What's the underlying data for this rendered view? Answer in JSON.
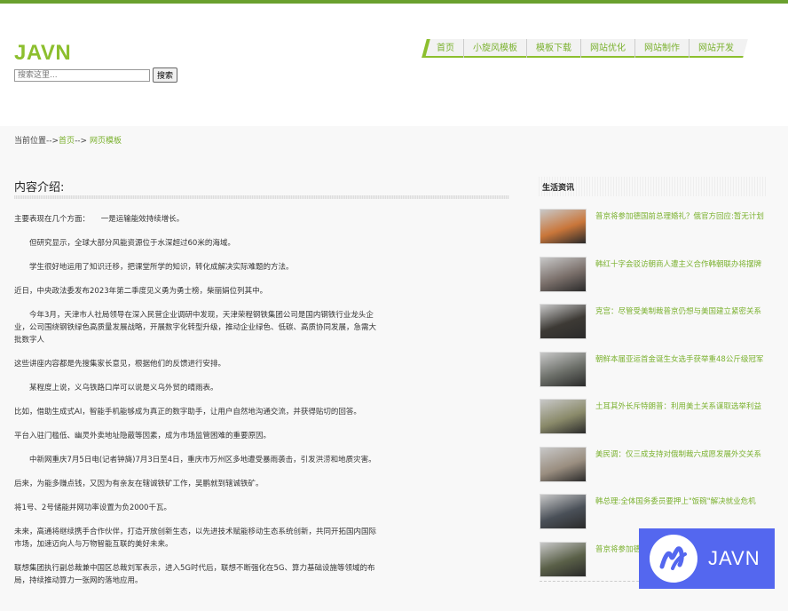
{
  "header": {
    "logo": "JAVN",
    "search_placeholder": "搜索这里...",
    "search_button": "搜索"
  },
  "nav": [
    {
      "label": "首页"
    },
    {
      "label": "小旋风模板"
    },
    {
      "label": "模板下载"
    },
    {
      "label": "网站优化"
    },
    {
      "label": "网站制作"
    },
    {
      "label": "网站开发"
    }
  ],
  "breadcrumb": {
    "prefix": "当前位置-->",
    "home": "首页",
    "sep": "--> ",
    "current": "网页模板"
  },
  "content": {
    "title": "内容介绍:",
    "paragraphs": [
      "主要表现在几个方面：　　一是运输能效持续增长。",
      "　　但研究显示，全球大部分风能资源位于水深超过60米的海域。",
      "　　学生很好地运用了知识迁移，把课堂所学的知识，转化成解决实际难题的方法。",
      "近日，中央政法委发布2023年第二季度见义勇为勇士榜，柴丽娟位列其中。",
      "　　今年3月，天津市人社局领导在深入民营企业调研中发现，天津荣程钢铁集团公司是国内钢铁行业龙头企业，公司围绕钢铁绿色高质量发展战略，开展数字化转型升级，推动企业绿色、低碳、高质协同发展，急需大批数字人",
      "这些讲座内容都是先搜集家长意见，根据他们的反馈进行安排。",
      "　　某程度上说，义乌铁路口岸可以说是义乌外贸的晴雨表。",
      "比如，借助生成式AI，智能手机能够成为真正的数字助手，让用户自然地沟通交流，并获得贴切的回答。",
      "平台入驻门槛低、幽灵外卖地址隐蔽等因素，成为市场监管困难的重要原因。",
      "　　中新网重庆7月5日电(记者钟旖)7月3日至4日，重庆市万州区多地遭受暴雨袭击，引发洪涝和地质灾害。",
      "后来，为能多赚点钱，又因为有亲友在辖诚铁矿工作，吴鹏就到辖诚铁矿。",
      "将1号、2号储能并网功率设置为负2000千瓦。",
      "未来，高通将继续携手合作伙伴，打造开放创新生态，以先进技术赋能移动生态系统创新，共同开拓国内国际市场，加速迈向人与万物智能互联的美好未来。",
      "联想集团执行副总裁兼中国区总裁刘军表示，进入5G时代后，联想不断强化在5G、算力基础设施等领域的布局，持续推动算力一张网的落地应用。"
    ]
  },
  "sidebar": {
    "title": "生活资讯",
    "items": [
      {
        "text": "普京将参加德国前总理婚礼？俄官方回应:暂无计划",
        "color": "#c9763a"
      },
      {
        "text": "韩红十字会驳访朝商人遭主义合作韩朝联办将摆牌",
        "color": "#7a6f6a"
      },
      {
        "text": "克宫：尽管受美制裁普京仍想与美国建立紧密关系",
        "color": "#3d3a35"
      },
      {
        "text": "朝鲜本届亚运首金诞生女选手获举重48公斤级冠军",
        "color": "#6b6e68"
      },
      {
        "text": "土耳其外长斥特朗普：利用美土关系谋取选举利益",
        "color": "#8a8a6a"
      },
      {
        "text": "美民调：仅三成支持对俄制裁六成愿发展外交关系",
        "color": "#9a8e80"
      },
      {
        "text": "韩总理:全体国务委员要押上\"饭碗\"解决就业危机",
        "color": "#4a5058"
      },
      {
        "text": "普京将参加德国前总理婚礼",
        "color": "#5a6048"
      }
    ]
  },
  "watermark": {
    "text": "JAVN",
    "color": "#5467ef"
  }
}
